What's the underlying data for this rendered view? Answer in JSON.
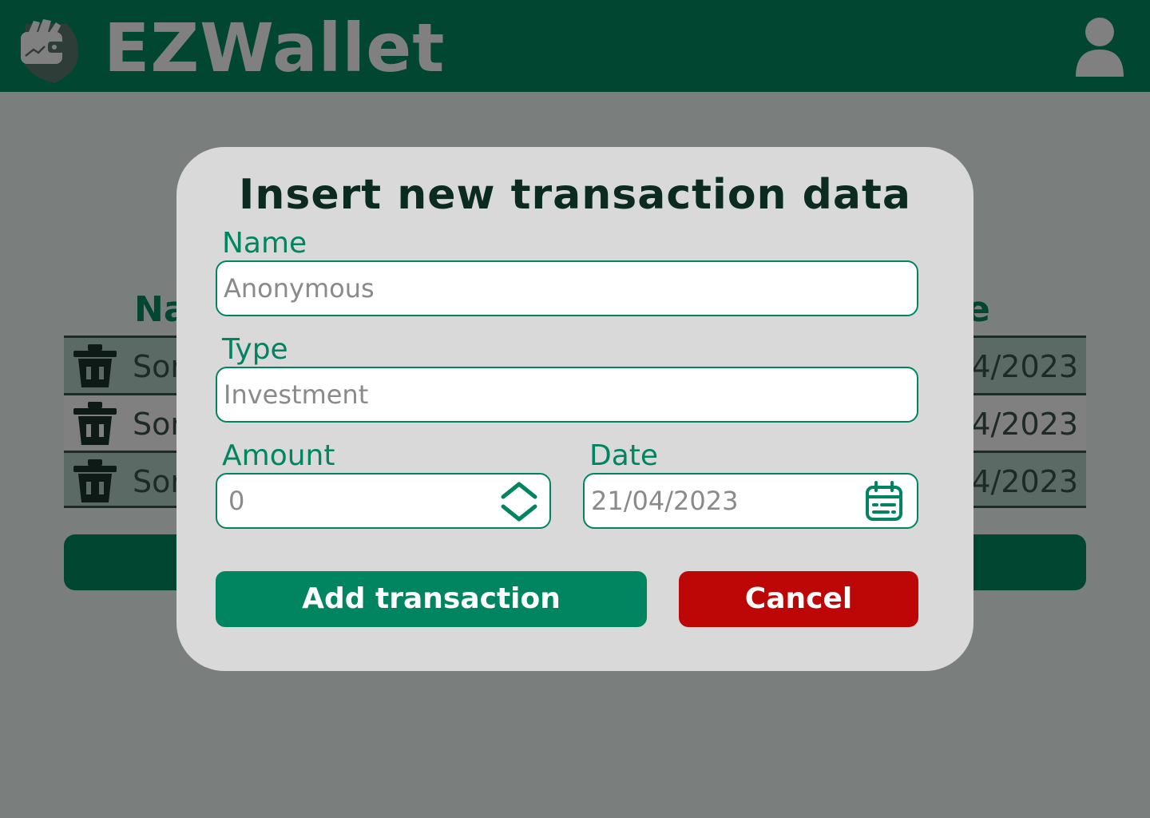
{
  "header": {
    "app_title": "EZWallet",
    "logo_icon": "wallet-logo-icon",
    "profile_icon": "user-profile-icon"
  },
  "background_table": {
    "columns": [
      "Na",
      "e"
    ],
    "rows": [
      {
        "name": "Sor",
        "date": "4/2023"
      },
      {
        "name": "Sor",
        "date": "4/2023"
      },
      {
        "name": "Sor",
        "date": "4/2023"
      }
    ]
  },
  "modal": {
    "title": "Insert new transaction data",
    "name": {
      "label": "Name",
      "placeholder": "Anonymous"
    },
    "type": {
      "label": "Type",
      "placeholder": "Investment"
    },
    "amount": {
      "label": "Amount",
      "placeholder": "0"
    },
    "date": {
      "label": "Date",
      "placeholder": "21/04/2023"
    },
    "add_button": "Add transaction",
    "cancel_button": "Cancel"
  },
  "colors": {
    "header_bg": "#004631",
    "accent_green": "#008560",
    "cancel_red": "#bd0606",
    "modal_bg": "#d9d9d9",
    "overlay": "#7a7f7e"
  }
}
